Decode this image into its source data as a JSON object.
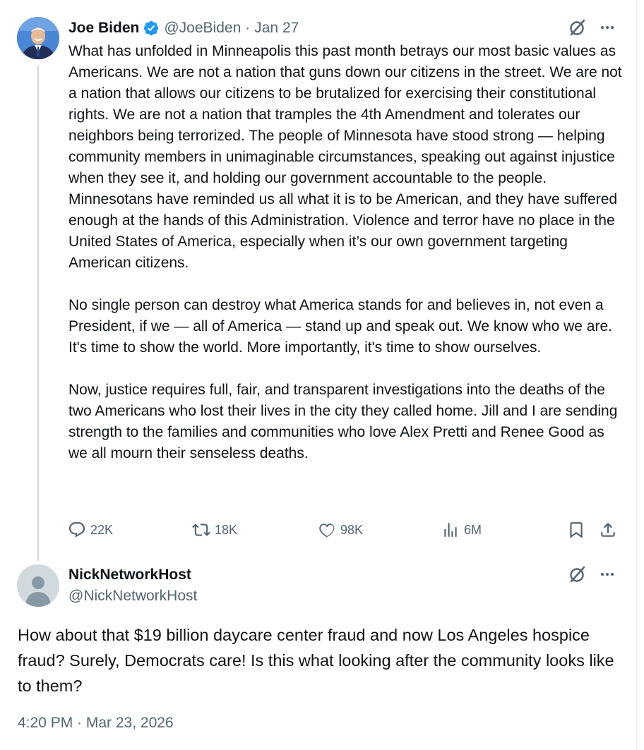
{
  "original_tweet": {
    "author_name": "Joe Biden",
    "handle": "@JoeBiden",
    "separator": "·",
    "date": "Jan 27",
    "paragraphs": [
      "What has unfolded in Minneapolis this past month betrays our most basic values as Americans. We are not a nation that guns down our citizens in the street. We are not a nation that allows our citizens to be brutalized for exercising their constitutional rights. We are not a nation that tramples the 4th Amendment and tolerates our neighbors being terrorized. The people of Minnesota have stood strong — helping community members in unimaginable circumstances, speaking out against injustice when they see it, and holding our government accountable to the people. Minnesotans have reminded us all what it is to be American, and they have suffered enough at the hands of this Administration. Violence and terror have no place in the United States of America, especially when it’s our own government targeting American citizens.",
      "No single person can destroy what America stands for and believes in, not even a President, if we — all of America — stand up and speak out. We know who we are. It's time to show the world. More importantly, it's time to show ourselves.",
      "Now, justice requires full, fair, and transparent investigations into the deaths of the two Americans who lost their lives in the city they called home. Jill and I are sending strength to the families and communities who love Alex Pretti and Renee Good as we all mourn their senseless deaths."
    ],
    "actions": {
      "replies": "22K",
      "reposts": "18K",
      "likes": "98K",
      "views": "6M"
    }
  },
  "reply": {
    "author_name": "NickNetworkHost",
    "handle": "@NickNetworkHost",
    "text": "How about that $19 billion daycare center fraud and now Los Angeles hospice fraud? Surely, Democrats care! Is this what looking after the community looks like to them?",
    "timestamp": "4:20 PM · Mar 23, 2026"
  },
  "icons": {
    "verified": "verified-badge-icon",
    "grok": "grok-icon",
    "more": "more-icon",
    "reply": "reply-icon",
    "repost": "repost-icon",
    "like": "like-icon",
    "views": "views-icon",
    "bookmark": "bookmark-icon",
    "share": "share-icon"
  },
  "colors": {
    "text": "#0f1419",
    "muted": "#536471",
    "verified_blue": "#1d9bf0",
    "thread_line": "#cfd9de",
    "default_avatar": "#cfd9de"
  }
}
